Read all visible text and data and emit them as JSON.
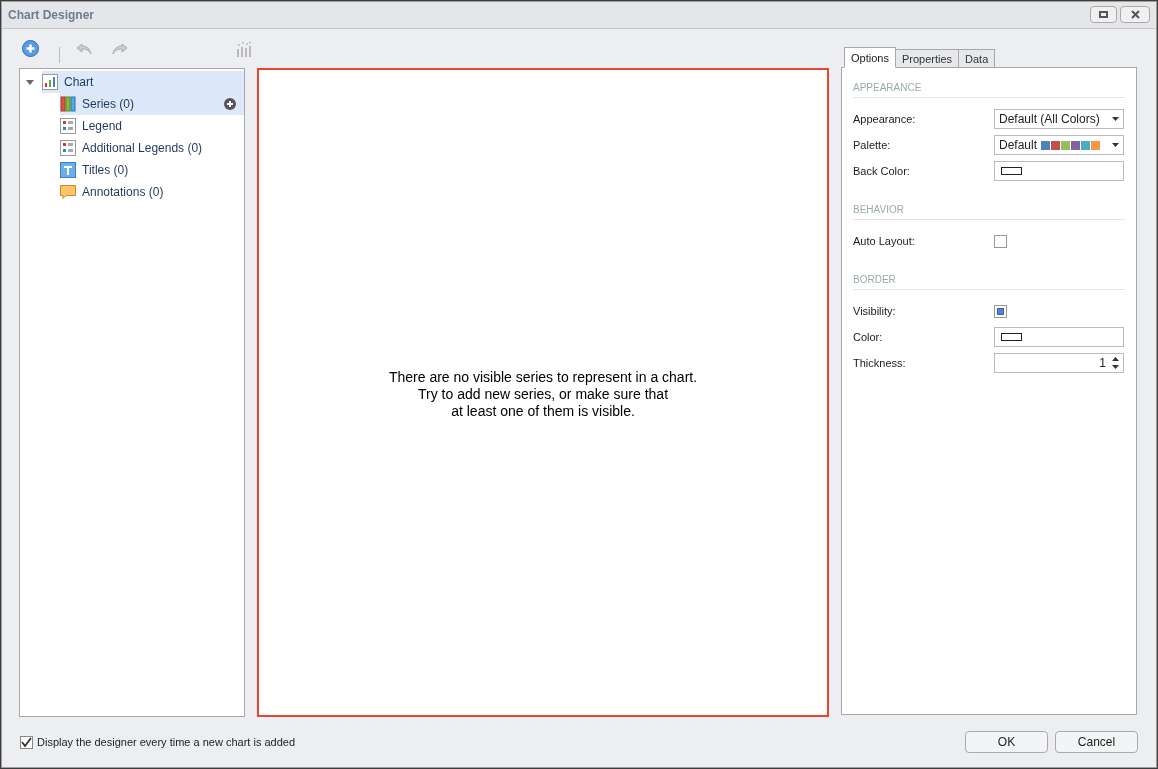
{
  "window": {
    "title": "Chart Designer"
  },
  "tree": [
    {
      "label": "Chart",
      "kind": "chart",
      "selected": true,
      "expanded": true,
      "children": [
        {
          "label": "Series (0)",
          "kind": "series",
          "selected": true,
          "add_button": true
        },
        {
          "label": "Legend",
          "kind": "legend",
          "selected": false
        },
        {
          "label": "Additional Legends (0)",
          "kind": "legend",
          "selected": false
        },
        {
          "label": "Titles (0)",
          "kind": "titles",
          "selected": false
        },
        {
          "label": "Annotations (0)",
          "kind": "annotations",
          "selected": false
        }
      ]
    }
  ],
  "chart_message": [
    "There are no visible series to represent in a chart.",
    "Try to add new series, or make sure that",
    "at least one of them is visible."
  ],
  "tabs": [
    {
      "label": "Options",
      "selected": true
    },
    {
      "label": "Properties",
      "selected": false
    },
    {
      "label": "Data",
      "selected": false
    }
  ],
  "sections": [
    {
      "title": "APPEARANCE",
      "rows": [
        {
          "label": "Appearance:",
          "kind": "dropdown",
          "value": "Default (All Colors)"
        },
        {
          "label": "Palette:",
          "kind": "palette",
          "value": "Default",
          "swatches": [
            {
              "color": "#4f81bd"
            },
            {
              "color": "#c0504d"
            },
            {
              "color": "#9bbb59"
            },
            {
              "color": "#8064a2"
            },
            {
              "color": "#4bacc6"
            },
            {
              "color": "#f79646"
            }
          ]
        },
        {
          "label": "Back Color:",
          "kind": "color"
        }
      ]
    },
    {
      "title": "BEHAVIOR",
      "rows": [
        {
          "label": "Auto Layout:",
          "kind": "checkbox",
          "checked": false
        }
      ]
    },
    {
      "title": "BORDER",
      "rows": [
        {
          "label": "Visibility:",
          "kind": "checkbox",
          "checked": true
        },
        {
          "label": "Color:",
          "kind": "color"
        },
        {
          "label": "Thickness:",
          "kind": "spin",
          "value": "1"
        }
      ]
    }
  ],
  "footer": {
    "checkbox": {
      "label": "Display the designer every time a new chart is added",
      "checked": true
    },
    "buttons": [
      "OK",
      "Cancel"
    ]
  }
}
